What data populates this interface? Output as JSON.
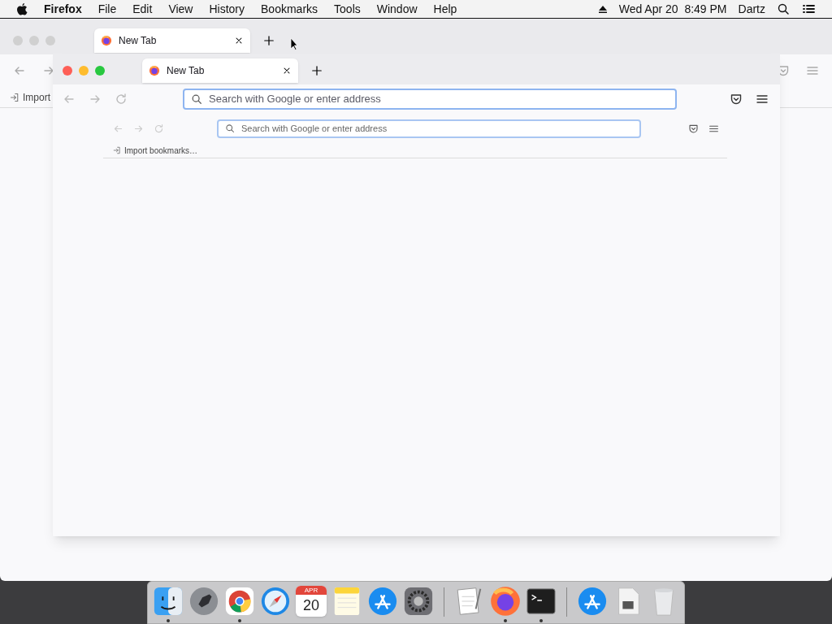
{
  "menu_bar": {
    "app": "Firefox",
    "items": [
      "File",
      "Edit",
      "View",
      "History",
      "Bookmarks",
      "Tools",
      "Window",
      "Help"
    ],
    "clock": "Wed Apr 20  8:49 PM",
    "user": "Dartz"
  },
  "windows": [
    {
      "active": false,
      "tab": {
        "title": "New Tab",
        "selected": true
      },
      "bookmark": "Import"
    },
    {
      "active": true,
      "tab": {
        "title": "New Tab",
        "selected": true
      },
      "placeholder": "Search with Google or enter address"
    },
    {
      "placeholder": "Search with Google or enter address",
      "bookmark": "Import bookmarks…"
    }
  ],
  "dock": [
    {
      "kind": "finder",
      "running": true
    },
    {
      "kind": "launchpad",
      "running": false
    },
    {
      "kind": "chrome",
      "running": true
    },
    {
      "kind": "safari",
      "running": false
    },
    {
      "kind": "calendar",
      "running": false,
      "month": "APR",
      "day": "20"
    },
    {
      "kind": "notes",
      "running": false
    },
    {
      "kind": "appstore",
      "running": false
    },
    {
      "kind": "settings",
      "running": false
    },
    {
      "kind": "divider"
    },
    {
      "kind": "textedit",
      "running": false
    },
    {
      "kind": "firefox",
      "running": true
    },
    {
      "kind": "terminal",
      "running": true
    },
    {
      "kind": "divider"
    },
    {
      "kind": "appstore",
      "running": false
    },
    {
      "kind": "disk",
      "running": false
    },
    {
      "kind": "trash",
      "running": false
    }
  ]
}
